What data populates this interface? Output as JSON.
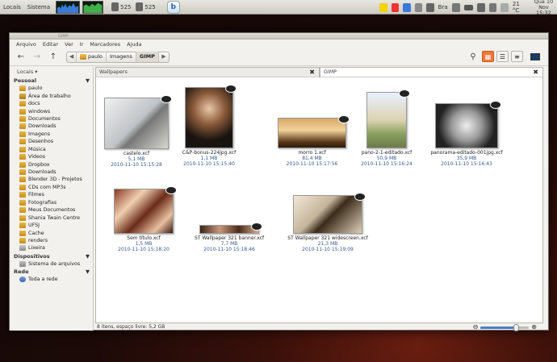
{
  "panel": {
    "menus": [
      "Locais",
      "Sistema"
    ],
    "counters": [
      "525",
      "525"
    ],
    "keyboard": "Bra",
    "temperature": "21 °C",
    "date": "Qua 10 Nov",
    "time": "15:32"
  },
  "window": {
    "title": "GIMP",
    "menu": [
      "Arquivo",
      "Editar",
      "Ver",
      "Ir",
      "Marcadores",
      "Ajuda"
    ],
    "breadcrumbs": [
      "paulo",
      "Imagens",
      "GIMP"
    ],
    "active_crumb": "GIMP"
  },
  "sidebar": {
    "header": "Locais",
    "sections": [
      {
        "title": "Pessoal",
        "items": [
          "paulo",
          "Área de trabalho",
          "docs",
          "windows",
          "Documentos",
          "Downloads",
          "Imagens",
          "Desenhos",
          "Música",
          "Vídeos",
          "Dropbox",
          "Downloads",
          "Blender 3D - Projetos",
          "CDs com MP3s",
          "Filmes",
          "Fotografias",
          "Meus Documentos",
          "Shania Twain Centre",
          "UFSJ",
          "Cache",
          "renders",
          "Lixeira"
        ]
      },
      {
        "title": "Dispositivos",
        "items": [
          "Sistema de arquivos"
        ]
      },
      {
        "title": "Rede",
        "items": [
          "Toda a rede"
        ]
      }
    ]
  },
  "panes": {
    "left_tab": "Wallpapers",
    "right_tab": "GIMP"
  },
  "files": [
    {
      "name": "castelo.xcf",
      "size": "5,1 MB",
      "date": "2010-11-10 15:15:28"
    },
    {
      "name": "C&P-bonus-224jpg.xcf",
      "size": "1,1 MB",
      "date": "2010-11-10 15:15:40"
    },
    {
      "name": "morro 1.xcf",
      "size": "81,4 MB",
      "date": "2010-11-10 15:17:56"
    },
    {
      "name": "pano-2-1-editado.xcf",
      "size": "50,9 MB",
      "date": "2010-11-10 15:16:24"
    },
    {
      "name": "panorama-editado-001jpg.xcf",
      "size": "35,9 MB",
      "date": "2010-11-10 15:16:43"
    },
    {
      "name": "Sem título.xcf",
      "size": "1,5 MB",
      "date": "2010-11-10 15:18:20"
    },
    {
      "name": "ST Wallpaper 321 banner.xcf",
      "size": "7,7 MB",
      "date": "2010-11-10 15:18:46"
    },
    {
      "name": "ST Wallpaper 321 widescreen.xcf",
      "size": "21,3 MB",
      "date": "2010-11-10 15:19:09"
    }
  ],
  "status": "8 itens, espaço livre: 5,2 GB",
  "zoom_level": 0.75,
  "colors": {
    "accent": "#f07a3a",
    "meta_text": "#355a8e"
  }
}
